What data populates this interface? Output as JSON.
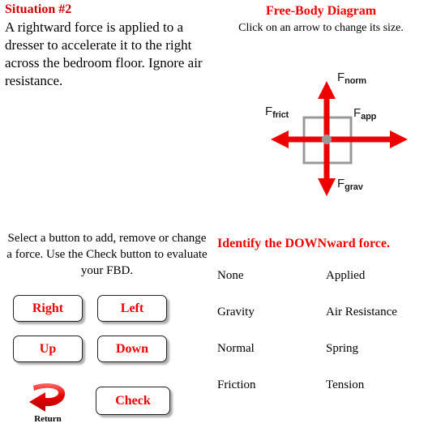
{
  "situation": {
    "title": "Situation #2",
    "description": "A rightward force is applied to a dresser to accelerate it to the right across the bedroom floor. Ignore air resistance."
  },
  "fbd": {
    "title": "Free-Body Diagram",
    "subtitle": "Click on an arrow to change its size.",
    "colors": {
      "arrow": "#ee0000",
      "box": "#999999",
      "dot": "#999999"
    },
    "arrows": [
      {
        "name": "normal",
        "direction": "up",
        "label_base": "F",
        "label_sub": "norm"
      },
      {
        "name": "gravity",
        "direction": "down",
        "label_base": "F",
        "label_sub": "grav"
      },
      {
        "name": "friction",
        "direction": "left",
        "label_base": "F",
        "label_sub": "frict"
      },
      {
        "name": "applied",
        "direction": "right",
        "label_base": "F",
        "label_sub": "app"
      }
    ]
  },
  "controls": {
    "instructions": "Select a button to add, remove or change a force. Use the Check button to evaluate your FBD.",
    "buttons": {
      "right": "Right",
      "left": "Left",
      "up": "Up",
      "down": "Down",
      "check": "Check"
    },
    "return": {
      "label": "Return",
      "icon": "return-arrow-icon"
    }
  },
  "question": {
    "prompt": "Identify the DOWNward force.",
    "options": [
      "None",
      "Applied",
      "Gravity",
      "Air Resistance",
      "Normal",
      "Spring",
      "Friction",
      "Tension"
    ]
  }
}
